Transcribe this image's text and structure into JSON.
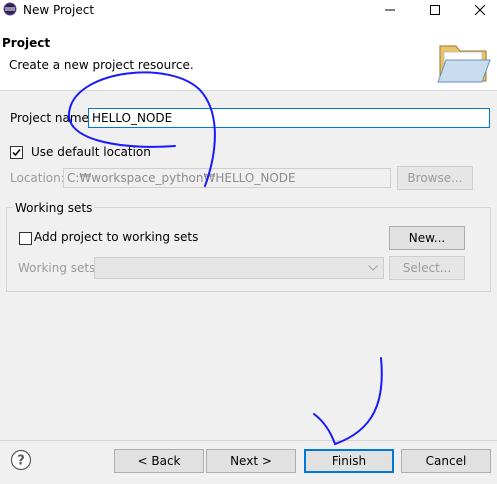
{
  "window": {
    "title": "New Project",
    "icons": [
      "eclipse-app-icon",
      "minimize-icon",
      "maximize-icon",
      "close-icon"
    ]
  },
  "header": {
    "title": "Project",
    "description": "Create a new project resource.",
    "icon": "folder-icon"
  },
  "form": {
    "project_name_label": "Project name:",
    "project_name_value": "HELLO_NODE",
    "use_default_label": "Use default location",
    "use_default_checked": true,
    "location_label": "Location:",
    "location_value": "C:₩workspace_python₩HELLO_NODE",
    "browse_label": "Browse..."
  },
  "working_sets": {
    "group_title": "Working sets",
    "add_label": "Add project to working sets",
    "add_checked": false,
    "new_label": "New...",
    "sets_label": "Working sets:",
    "sets_value": "",
    "select_label": "Select..."
  },
  "footer": {
    "help_icon": "help-icon",
    "back_label": "< Back",
    "next_label": "Next >",
    "finish_label": "Finish",
    "cancel_label": "Cancel"
  },
  "colors": {
    "annotation": "#1a1aff",
    "default_button_border": "#0078d7",
    "disabled_text": "#9a9a9a"
  }
}
